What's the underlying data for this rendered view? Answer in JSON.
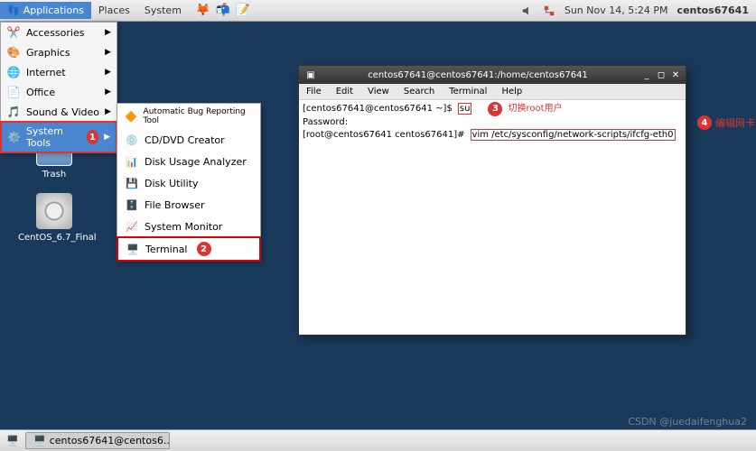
{
  "panel": {
    "applications": "Applications",
    "places": "Places",
    "system": "System",
    "datetime": "Sun Nov 14,  5:24 PM",
    "user": "centos67641"
  },
  "desktop": {
    "trash": "Trash",
    "cd": "CentOS_6.7_Final"
  },
  "appmenu": {
    "items": [
      {
        "label": "Accessories"
      },
      {
        "label": "Graphics"
      },
      {
        "label": "Internet"
      },
      {
        "label": "Office"
      },
      {
        "label": "Sound & Video"
      },
      {
        "label": "System Tools"
      }
    ]
  },
  "submenu": {
    "items": [
      {
        "label": "Automatic Bug Reporting Tool"
      },
      {
        "label": "CD/DVD Creator"
      },
      {
        "label": "Disk Usage Analyzer"
      },
      {
        "label": "Disk Utility"
      },
      {
        "label": "File Browser"
      },
      {
        "label": "System Monitor"
      },
      {
        "label": "Terminal"
      }
    ]
  },
  "terminal": {
    "title": "centos67641@centos67641:/home/centos67641",
    "menus": [
      "File",
      "Edit",
      "View",
      "Search",
      "Terminal",
      "Help"
    ],
    "line1_prefix": "[centos67641@centos67641 ~]$",
    "line1_cmd": "su",
    "line2": "Password:",
    "line3_prefix": "[root@centos67641 centos67641]#",
    "line3_cmd": "vim /etc/sysconfig/network-scripts/ifcfg-eth0"
  },
  "annotations": {
    "b1": "1",
    "b2": "2",
    "b3": "3",
    "b3_text": "切换root用户",
    "b4": "4",
    "b4_text": "编辑网卡"
  },
  "taskbar": {
    "item1": "centos67641@centos6..."
  },
  "watermark": "CSDN @juedaifenghua2"
}
